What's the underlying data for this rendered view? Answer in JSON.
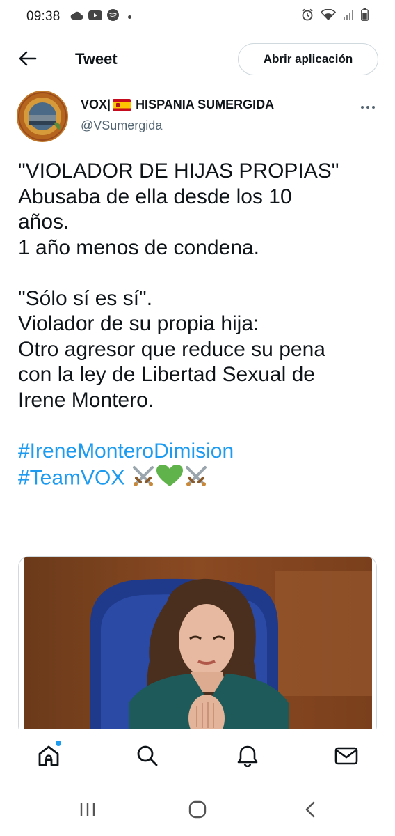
{
  "status_bar": {
    "time": "09:38",
    "left_icons": [
      "cloud-icon",
      "youtube-icon",
      "spotify-icon",
      "dot-icon"
    ],
    "right_icons": [
      "alarm-icon",
      "wifi-icon",
      "signal-icon",
      "battery-icon"
    ]
  },
  "header": {
    "title": "Tweet",
    "open_app_label": "Abrir aplicación"
  },
  "author": {
    "name_prefix": "VOX|",
    "name_suffix": "HISPANIA SUMERGIDA",
    "handle": "@VSumergida"
  },
  "tweet": {
    "lines": [
      "\"VIOLADOR DE HIJAS PROPIAS\"",
      "Abusaba de ella desde los 10",
      "años.",
      "1 año menos de condena.",
      "",
      "\"Sólo sí es sí\".",
      "Violador de su propia hija:",
      "Otro agresor que reduce su pena",
      "con la ley de Libertad Sexual de",
      "Irene Montero."
    ],
    "hashtag1": "#IreneMonteroDimision",
    "hashtag2": "#TeamVOX",
    "emojis": [
      "crossed-swords-icon",
      "green-heart-icon",
      "crossed-swords-icon"
    ]
  },
  "bottom_nav": [
    "home-icon",
    "search-icon",
    "notifications-icon",
    "messages-icon"
  ],
  "colors": {
    "accent": "#1d9bf0",
    "text": "#0f1419",
    "secondary": "#536471"
  }
}
